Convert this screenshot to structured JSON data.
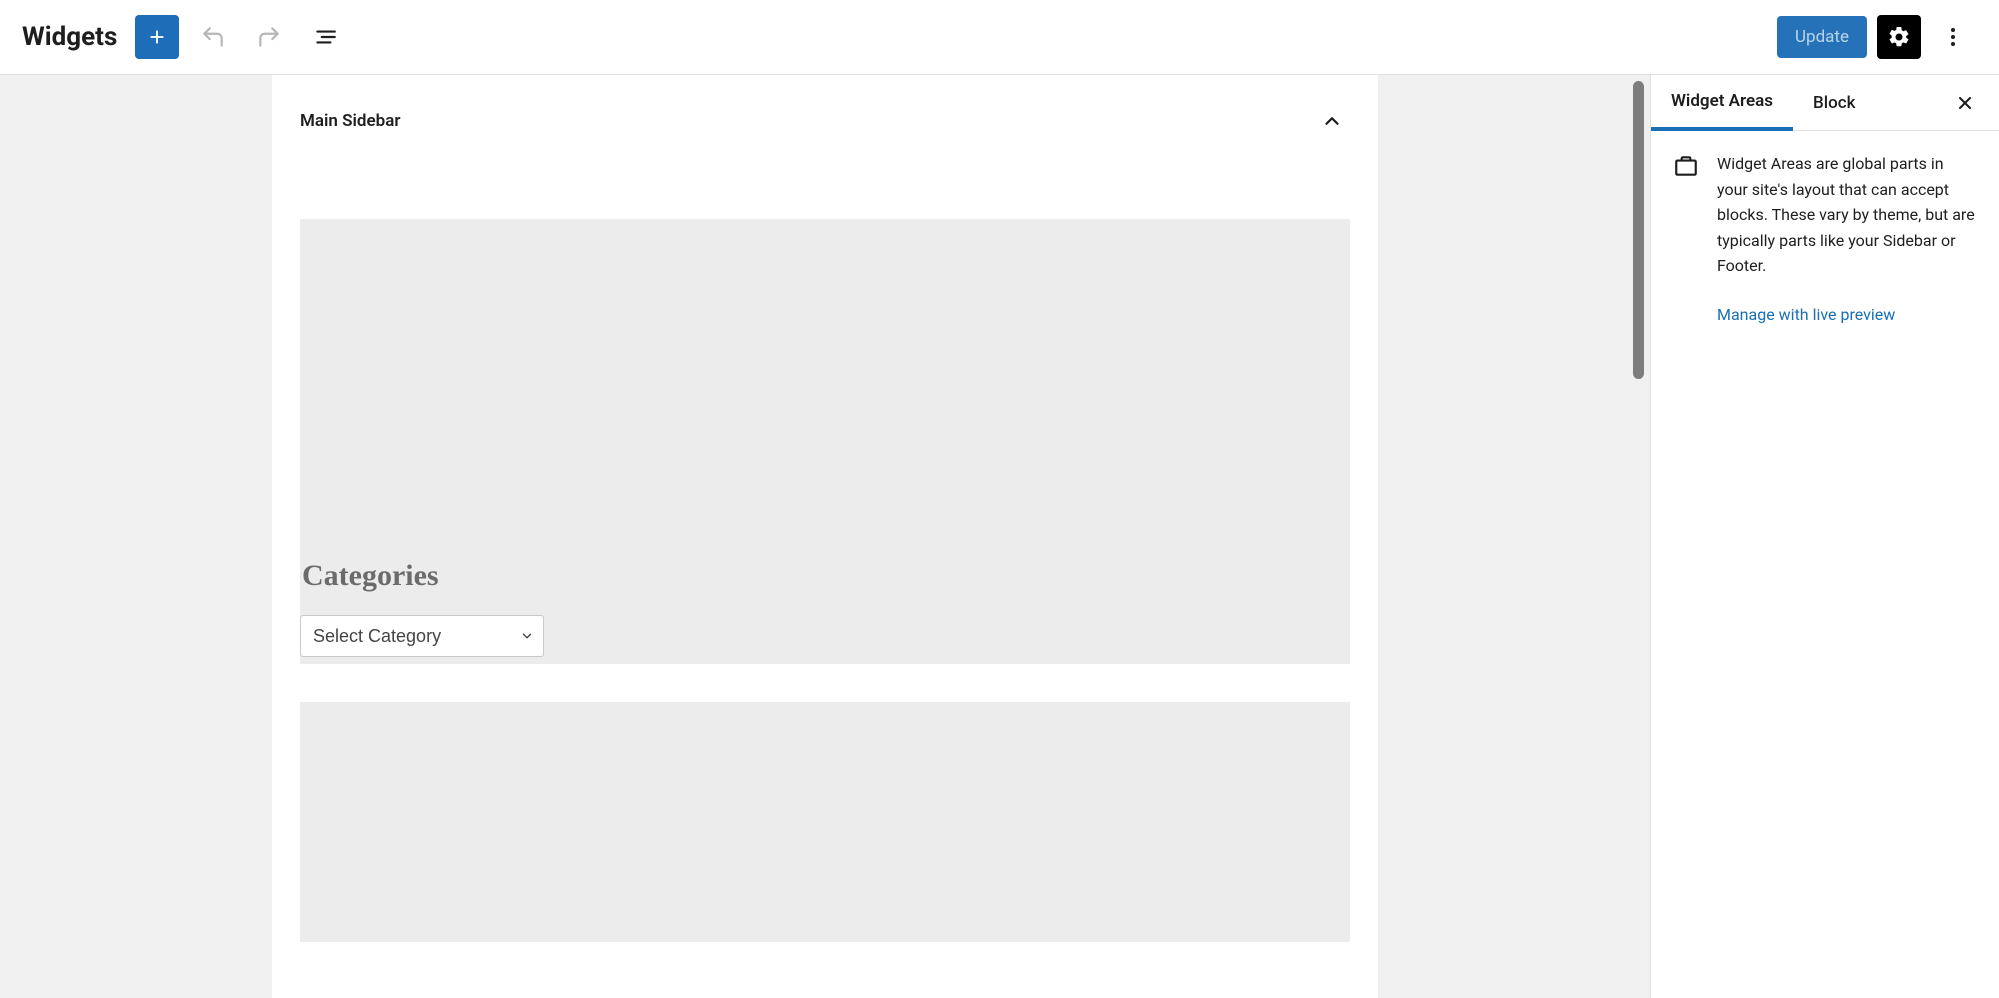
{
  "header": {
    "title": "Widgets",
    "update_label": "Update"
  },
  "canvas": {
    "panels": [
      {
        "title": "Main Sidebar",
        "blocks": [
          {
            "heading": "Categories",
            "select_placeholder": "Select Category"
          }
        ]
      }
    ]
  },
  "sidebar": {
    "tabs": [
      {
        "label": "Widget Areas",
        "active": true
      },
      {
        "label": "Block",
        "active": false
      }
    ],
    "description": "Widget Areas are global parts in your site's layout that can accept blocks. These vary by theme, but are typically parts like your Sidebar or Footer.",
    "live_preview_label": "Manage with live preview"
  }
}
